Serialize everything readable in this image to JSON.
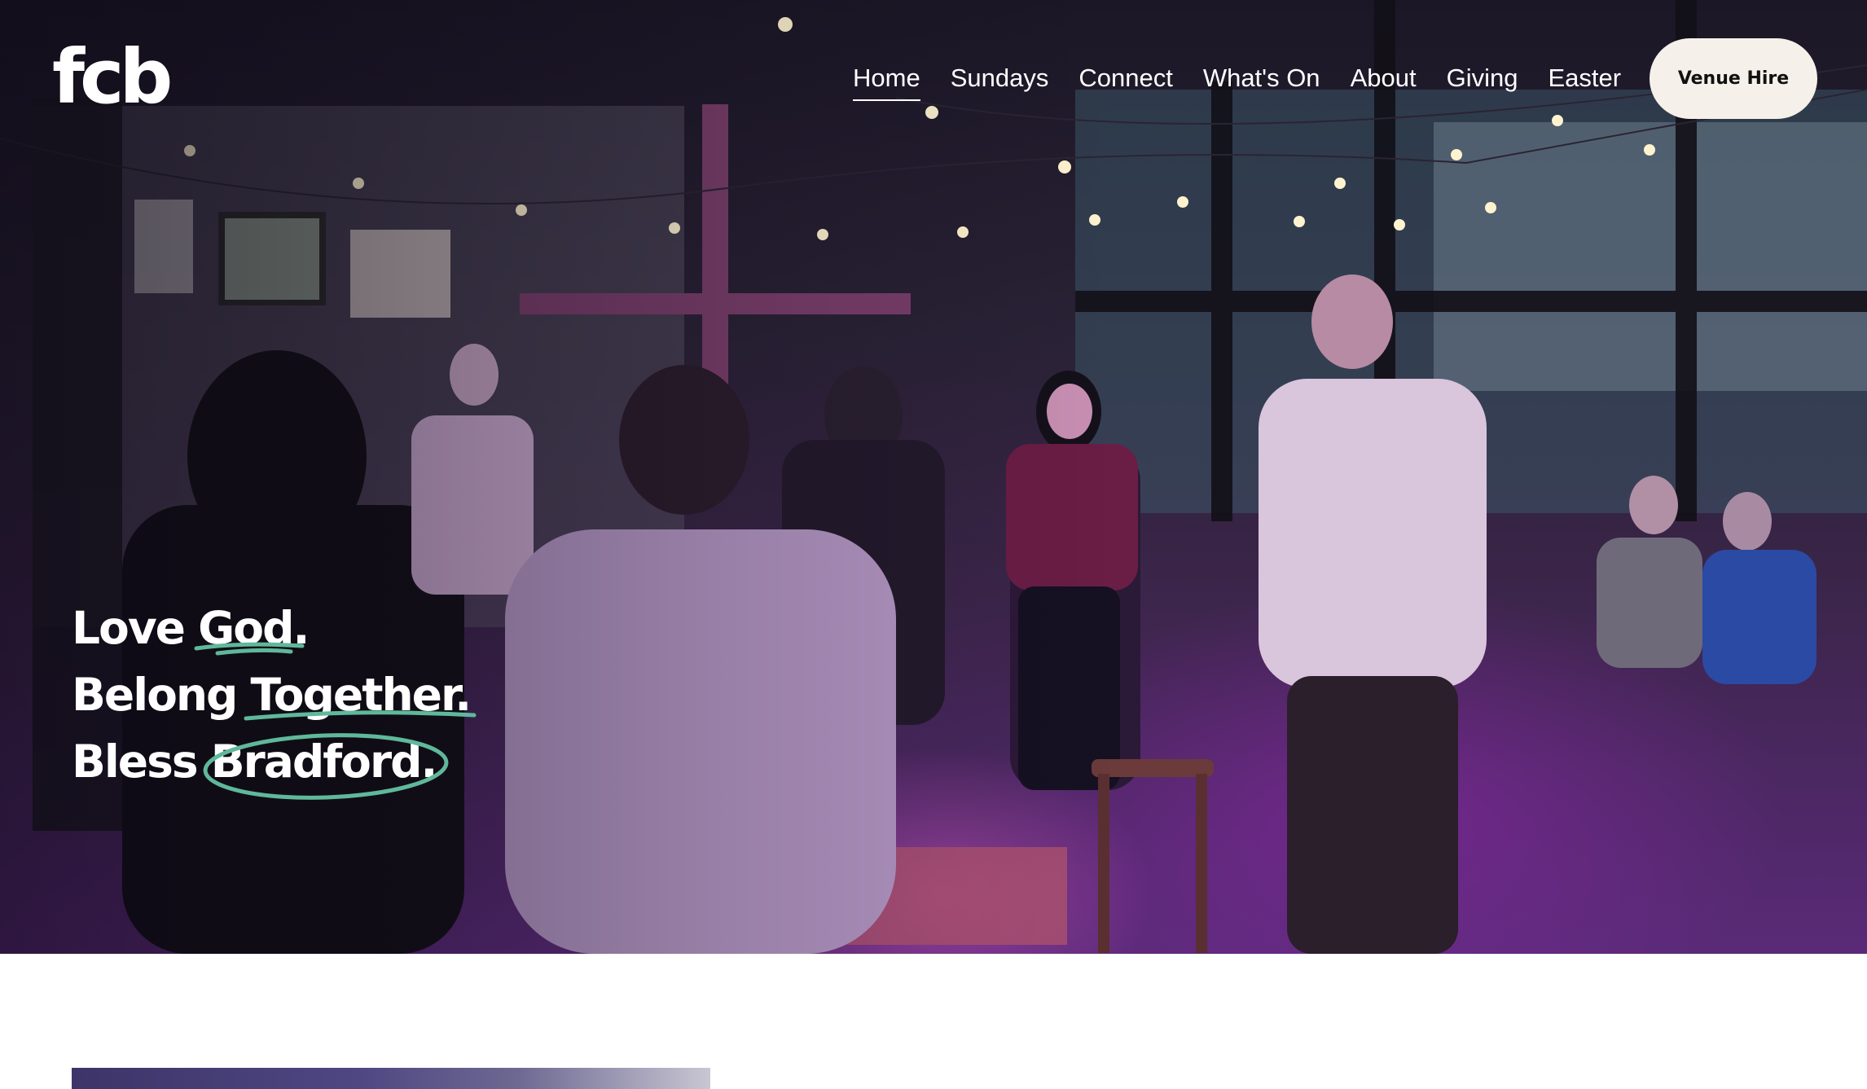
{
  "brand": {
    "logo_text": "fcb"
  },
  "nav": {
    "items": [
      {
        "label": "Home",
        "active": true
      },
      {
        "label": "Sundays",
        "active": false
      },
      {
        "label": "Connect",
        "active": false
      },
      {
        "label": "What's On",
        "active": false
      },
      {
        "label": "About",
        "active": false
      },
      {
        "label": "Giving",
        "active": false
      },
      {
        "label": "Easter",
        "active": false
      }
    ],
    "cta_label": "Venue Hire"
  },
  "hero": {
    "lines": [
      {
        "prefix": "Love ",
        "accent": "God."
      },
      {
        "prefix": "Belong ",
        "accent": "Together."
      },
      {
        "prefix": "Bless ",
        "accent": "Bradford."
      }
    ],
    "accent_color": "#5fb89a",
    "photo": "worship band performing on stage in a hall lit with purple light, with a wooden cross and string lights"
  },
  "colors": {
    "hero_text": "#ffffff",
    "cta_background": "#f5f1ea",
    "page_background": "#ffffff"
  }
}
